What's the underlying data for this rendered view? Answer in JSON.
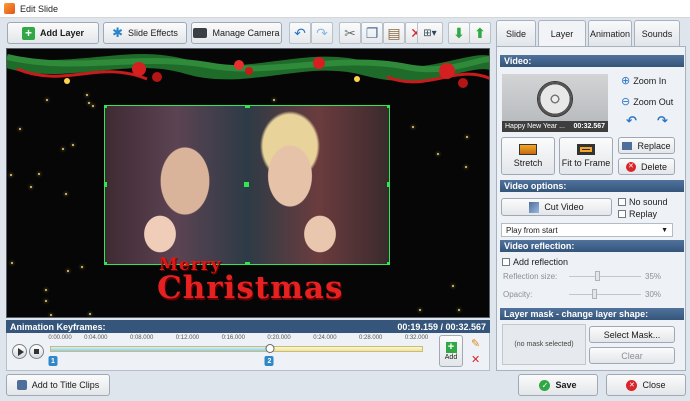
{
  "window": {
    "title": "Edit Slide"
  },
  "toolbar": {
    "add_layer": "Add Layer",
    "slide_effects": "Slide Effects",
    "manage_camera": "Manage Camera"
  },
  "preview": {
    "merry": "Merry",
    "christmas": "Christmas"
  },
  "keyframes": {
    "title": "Animation Keyframes:",
    "time": "00:19.159 / 00:32.567",
    "ticks": [
      "0:00.000",
      "0:04.000",
      "0:08.000",
      "0:12.000",
      "0:16.000",
      "0:20.000",
      "0:24.000",
      "0:28.000",
      "0:32.000"
    ],
    "timeline_max_seconds": 32.567,
    "keyframe_seconds": [
      0,
      19.159
    ],
    "marker1": "1",
    "marker2": "2",
    "add_label": "Add"
  },
  "tabs": [
    {
      "label": "Slide"
    },
    {
      "label": "Layer"
    },
    {
      "label": "Animation"
    },
    {
      "label": "Sounds"
    }
  ],
  "video": {
    "heading": "Video:",
    "clip_name": "Happy New Year ...",
    "clip_duration": "00:32.567",
    "zoom_in": "Zoom In",
    "zoom_out": "Zoom Out",
    "stretch": "Stretch",
    "fit_to_frame": "Fit to Frame",
    "replace": "Replace",
    "delete": "Delete"
  },
  "video_options": {
    "heading": "Video options:",
    "cut_video": "Cut Video",
    "no_sound": "No sound",
    "replay": "Replay",
    "play_mode": "Play from start"
  },
  "reflection": {
    "heading": "Video reflection:",
    "add_reflection": "Add reflection",
    "size_label": "Reflection size:",
    "size_value": "35%",
    "opacity_label": "Opacity:",
    "opacity_value": "30%"
  },
  "mask": {
    "heading": "Layer mask - change layer shape:",
    "placeholder": "(no mask selected)",
    "select_mask": "Select Mask...",
    "clear": "Clear"
  },
  "footer": {
    "add_to_title_clips": "Add to Title Clips",
    "save": "Save",
    "close": "Close"
  },
  "colors": {
    "accent": "#35557a",
    "selection": "#2fe84f",
    "save_icon": "#2fa845",
    "close_icon": "#d8262b"
  }
}
